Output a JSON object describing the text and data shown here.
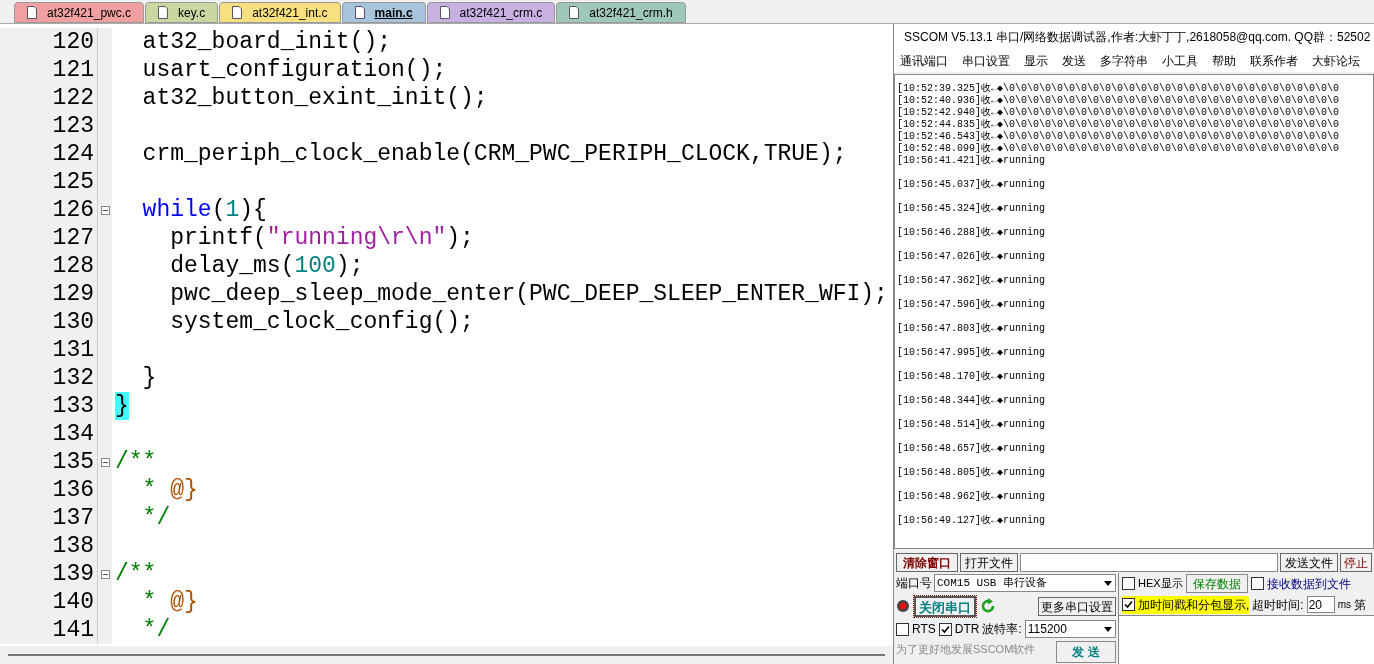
{
  "tabs": [
    {
      "label": "at32f421_pwc.c",
      "color": "#f0a0a0",
      "selected": false
    },
    {
      "label": "key.c",
      "color": "#c8d8a0",
      "selected": false
    },
    {
      "label": "at32f421_int.c",
      "color": "#f8e080",
      "selected": false
    },
    {
      "label": "main.c",
      "color": "#a8c4dc",
      "selected": true
    },
    {
      "label": "at32f421_crm.c",
      "color": "#c8b0e0",
      "selected": false
    },
    {
      "label": "at32f421_crm.h",
      "color": "#a0c8b8",
      "selected": false
    }
  ],
  "code_lines": [
    {
      "number": "120",
      "fold": false,
      "tokens": [
        {
          "kind": "plain",
          "text": "  at32_board_init();"
        }
      ]
    },
    {
      "number": "121",
      "fold": false,
      "tokens": [
        {
          "kind": "plain",
          "text": "  usart_configuration();"
        }
      ]
    },
    {
      "number": "122",
      "fold": false,
      "tokens": [
        {
          "kind": "plain",
          "text": "  at32_button_exint_init();"
        }
      ]
    },
    {
      "number": "123",
      "fold": false
    },
    {
      "number": "124",
      "fold": false,
      "tokens": [
        {
          "kind": "plain",
          "text": "  crm_periph_clock_enable(CRM_PWC_PERIPH_CLOCK,TRUE);"
        }
      ]
    },
    {
      "number": "125",
      "fold": false
    },
    {
      "number": "126",
      "fold": true,
      "tokens": [
        {
          "kind": "keyword",
          "text": "  while"
        },
        {
          "kind": "plain",
          "text": "("
        },
        {
          "kind": "number",
          "text": "1"
        },
        {
          "kind": "plain",
          "text": "){"
        }
      ]
    },
    {
      "number": "127",
      "fold": false,
      "tokens": [
        {
          "kind": "plain",
          "text": "    printf("
        },
        {
          "kind": "string",
          "text": "\"running\\r\\n\""
        },
        {
          "kind": "plain",
          "text": ");"
        }
      ]
    },
    {
      "number": "128",
      "fold": false,
      "tokens": [
        {
          "kind": "plain",
          "text": "    delay_ms("
        },
        {
          "kind": "number",
          "text": "100"
        },
        {
          "kind": "plain",
          "text": ");"
        }
      ]
    },
    {
      "number": "129",
      "fold": false,
      "tokens": [
        {
          "kind": "plain",
          "text": "    pwc_deep_sleep_mode_enter(PWC_DEEP_SLEEP_ENTER_WFI);"
        }
      ]
    },
    {
      "number": "130",
      "fold": false,
      "tokens": [
        {
          "kind": "plain",
          "text": "    system_clock_config();"
        }
      ]
    },
    {
      "number": "131",
      "fold": false
    },
    {
      "number": "132",
      "fold": false,
      "tokens": [
        {
          "kind": "plain",
          "text": "  }"
        }
      ]
    },
    {
      "number": "133",
      "fold": false,
      "tokens": [
        {
          "kind": "match",
          "text": "}"
        }
      ]
    },
    {
      "number": "134",
      "fold": false
    },
    {
      "number": "135",
      "fold": true,
      "tokens": [
        {
          "kind": "comment",
          "text": "/**"
        }
      ]
    },
    {
      "number": "136",
      "fold": false,
      "tokens": [
        {
          "kind": "comment",
          "text": "  * "
        },
        {
          "kind": "doc",
          "text": "@}"
        }
      ]
    },
    {
      "number": "137",
      "fold": false,
      "tokens": [
        {
          "kind": "comment",
          "text": "  */"
        }
      ]
    },
    {
      "number": "138",
      "fold": false
    },
    {
      "number": "139",
      "fold": true,
      "tokens": [
        {
          "kind": "comment",
          "text": "/**"
        }
      ]
    },
    {
      "number": "140",
      "fold": false,
      "tokens": [
        {
          "kind": "comment",
          "text": "  * "
        },
        {
          "kind": "doc",
          "text": "@}"
        }
      ]
    },
    {
      "number": "141",
      "fold": false,
      "tokens": [
        {
          "kind": "comment",
          "text": "  */"
        }
      ]
    }
  ],
  "sscom": {
    "title": "SSCOM V5.13.1 串口/网络数据调试器,作者:大虾丁丁,2618058@qq.com. QQ群：52502",
    "menu": [
      "通讯端口",
      "串口设置",
      "显示",
      "发送",
      "多字符串",
      "小工具",
      "帮助",
      "联系作者",
      "大虾论坛"
    ],
    "log": [
      {
        "kind": "dense",
        "text": "[10:52:39.325]收←◆\\0\\0\\0\\0\\0\\0\\0\\0\\0\\0\\0\\0\\0\\0\\0\\0\\0\\0\\0\\0\\0\\0\\0\\0\\0\\0\\0\\0"
      },
      {
        "kind": "dense",
        "text": "[10:52:40.936]收←◆\\0\\0\\0\\0\\0\\0\\0\\0\\0\\0\\0\\0\\0\\0\\0\\0\\0\\0\\0\\0\\0\\0\\0\\0\\0\\0\\0\\0"
      },
      {
        "kind": "dense",
        "text": "[10:52:42.940]收←◆\\0\\0\\0\\0\\0\\0\\0\\0\\0\\0\\0\\0\\0\\0\\0\\0\\0\\0\\0\\0\\0\\0\\0\\0\\0\\0\\0\\0"
      },
      {
        "kind": "dense",
        "text": "[10:52:44.835]收←◆\\0\\0\\0\\0\\0\\0\\0\\0\\0\\0\\0\\0\\0\\0\\0\\0\\0\\0\\0\\0\\0\\0\\0\\0\\0\\0\\0\\0"
      },
      {
        "kind": "dense",
        "text": "[10:52:46.543]收←◆\\0\\0\\0\\0\\0\\0\\0\\0\\0\\0\\0\\0\\0\\0\\0\\0\\0\\0\\0\\0\\0\\0\\0\\0\\0\\0\\0\\0"
      },
      {
        "kind": "dense",
        "text": "[10:52:48.099]收←◆\\0\\0\\0\\0\\0\\0\\0\\0\\0\\0\\0\\0\\0\\0\\0\\0\\0\\0\\0\\0\\0\\0\\0\\0\\0\\0\\0\\0"
      },
      {
        "kind": "spaced",
        "text": "[10:56:41.421]收←◆running"
      },
      {
        "kind": "spaced",
        "text": "[10:56:45.037]收←◆running"
      },
      {
        "kind": "spaced",
        "text": "[10:56:45.324]收←◆running"
      },
      {
        "kind": "spaced",
        "text": "[10:56:46.288]收←◆running"
      },
      {
        "kind": "spaced",
        "text": "[10:56:47.026]收←◆running"
      },
      {
        "kind": "spaced",
        "text": "[10:56:47.362]收←◆running"
      },
      {
        "kind": "spaced",
        "text": "[10:56:47.596]收←◆running"
      },
      {
        "kind": "spaced",
        "text": "[10:56:47.803]收←◆running"
      },
      {
        "kind": "spaced",
        "text": "[10:56:47.995]收←◆running"
      },
      {
        "kind": "spaced",
        "text": "[10:56:48.170]收←◆running"
      },
      {
        "kind": "spaced",
        "text": "[10:56:48.344]收←◆running"
      },
      {
        "kind": "spaced",
        "text": "[10:56:48.514]收←◆running"
      },
      {
        "kind": "spaced",
        "text": "[10:56:48.657]收←◆running"
      },
      {
        "kind": "spaced",
        "text": "[10:56:48.805]收←◆running"
      },
      {
        "kind": "spaced",
        "text": "[10:56:48.962]收←◆running"
      },
      {
        "kind": "spaced",
        "text": "[10:56:49.127]收←◆running"
      }
    ],
    "clear_button": "清除窗口",
    "open_file_button": "打开文件",
    "send_file_button": "发送文件",
    "stop_button": "停止",
    "port_label": "端口号",
    "port_value": "COM15 USB 串行设备",
    "hex_display": {
      "label": "HEX显示",
      "checked": false
    },
    "save_data_button": "保存数据",
    "receive_to_file": {
      "label": "接收数据到文件",
      "checked": false
    },
    "close_port_button": "关闭串口",
    "more_settings_button": "更多串口设置",
    "timestamp": {
      "label": "加时间戳和分包显示,",
      "checked": true
    },
    "timeout_label": "超时时间:",
    "timeout_value": "20",
    "timeout_unit": "ms",
    "cut_label": "第",
    "rts": {
      "label": "RTS",
      "checked": false
    },
    "dtr": {
      "label": "DTR",
      "checked": true
    },
    "baud_label": "波特率:",
    "baud_value": "115200",
    "promo": "为了更好地发展SSCOM软件",
    "send_button": "发 送"
  }
}
